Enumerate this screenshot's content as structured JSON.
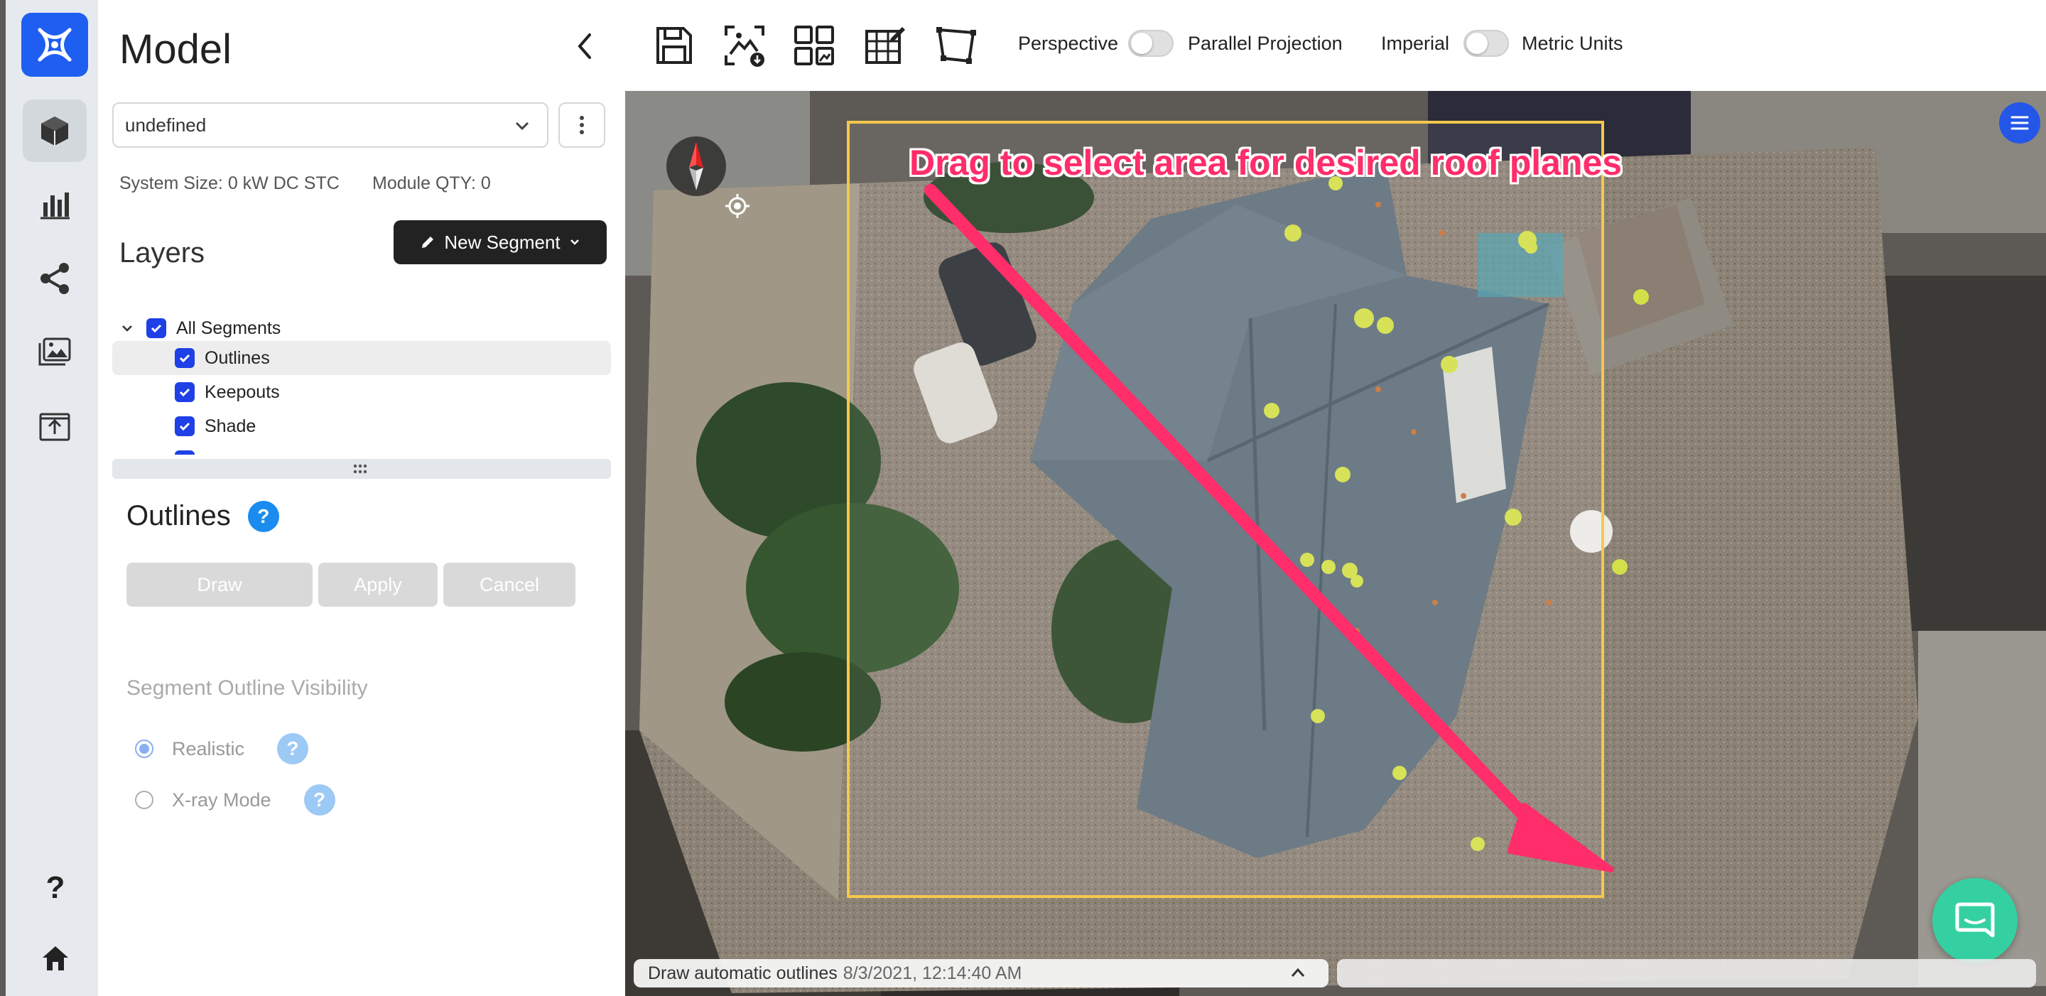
{
  "panel": {
    "title": "Model",
    "design_select": {
      "value": "undefined"
    },
    "system_size": "System Size: 0 kW DC STC",
    "module_qty": "Module QTY: 0",
    "layers_title": "Layers",
    "new_segment_label": "New Segment",
    "layers": [
      {
        "label": "All Segments",
        "checked": true
      },
      {
        "label": "Outlines",
        "checked": true
      },
      {
        "label": "Keepouts",
        "checked": true
      },
      {
        "label": "Shade",
        "checked": true
      }
    ],
    "outlines_title": "Outlines",
    "help_glyph": "?",
    "draw_label": "Draw",
    "apply_label": "Apply",
    "cancel_label": "Cancel",
    "visibility_title": "Segment Outline Visibility",
    "visibility_options": [
      {
        "label": "Realistic",
        "selected": true
      },
      {
        "label": "X-ray Mode",
        "selected": false
      }
    ]
  },
  "rail": {
    "icons": [
      "app-logo-icon",
      "model-cube-icon",
      "bar-chart-icon",
      "share-icon",
      "image-gallery-icon",
      "upload-icon",
      "help-icon",
      "home-icon"
    ],
    "help_glyph": "?"
  },
  "toolbar": {
    "tools": [
      "save-icon",
      "image-download-icon",
      "layout-grid-icon",
      "grid-edit-icon",
      "roof-shape-icon"
    ],
    "projection_left": "Perspective",
    "projection_right": "Parallel Projection",
    "units_left": "Imperial",
    "units_right": "Metric Units"
  },
  "map": {
    "annotation": "Drag to select area for desired roof planes",
    "status_label": "Draw automatic outlines",
    "status_timestamp": "8/3/2021, 12:14:40 AM"
  },
  "colors": {
    "accent_blue": "#1e40e6",
    "annotation_pink": "#ff2d6a",
    "selection_yellow": "#f5c84a",
    "chat_green": "#35d0a2"
  }
}
